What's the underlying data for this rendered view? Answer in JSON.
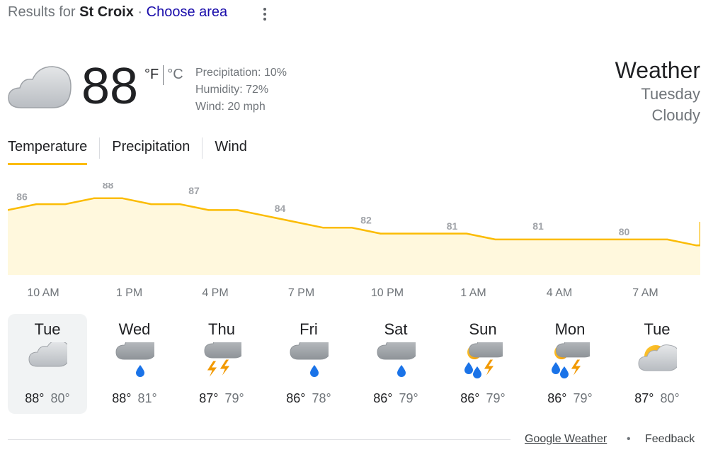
{
  "header": {
    "results_prefix": "Results for ",
    "place": "St Croix",
    "separator": " · ",
    "choose_area": "Choose area"
  },
  "current": {
    "icon": "cloud-icon",
    "temp": "88",
    "unit_f": "°F",
    "unit_c": "°C",
    "precipitation": "Precipitation: 10%",
    "humidity": "Humidity: 72%",
    "wind": "Wind: 20 mph"
  },
  "summary": {
    "title": "Weather",
    "day": "Tuesday",
    "condition": "Cloudy"
  },
  "tabs": [
    {
      "label": "Temperature",
      "active": true
    },
    {
      "label": "Precipitation",
      "active": false
    },
    {
      "label": "Wind",
      "active": false
    }
  ],
  "chart_data": {
    "type": "area",
    "x": [
      "10 AM",
      "1 PM",
      "4 PM",
      "7 PM",
      "10 PM",
      "1 AM",
      "4 AM",
      "7 AM"
    ],
    "labels": [
      86,
      88,
      87,
      84,
      82,
      81,
      81,
      80
    ],
    "hourly": [
      86,
      87,
      87,
      88,
      88,
      87,
      87,
      86,
      86,
      85,
      84,
      83,
      83,
      82,
      82,
      82,
      82,
      81,
      81,
      81,
      81,
      81,
      81,
      81,
      80,
      80,
      81,
      82,
      84
    ],
    "ylim": [
      75,
      90
    ],
    "line_color": "#fbbc04",
    "fill_color": "#fff8dd"
  },
  "forecast": [
    {
      "day": "Tue",
      "icon": "cloud-icon",
      "hi": "88°",
      "lo": "80°",
      "selected": true
    },
    {
      "day": "Wed",
      "icon": "rain-icon",
      "hi": "88°",
      "lo": "81°",
      "selected": false
    },
    {
      "day": "Thu",
      "icon": "thunderstorm-icon",
      "hi": "87°",
      "lo": "79°",
      "selected": false
    },
    {
      "day": "Fri",
      "icon": "rain-icon",
      "hi": "86°",
      "lo": "78°",
      "selected": false
    },
    {
      "day": "Sat",
      "icon": "rain-icon",
      "hi": "86°",
      "lo": "79°",
      "selected": false
    },
    {
      "day": "Sun",
      "icon": "scattered-thunderstorm-icon",
      "hi": "86°",
      "lo": "79°",
      "selected": false
    },
    {
      "day": "Mon",
      "icon": "scattered-thunderstorm-icon",
      "hi": "86°",
      "lo": "79°",
      "selected": false
    },
    {
      "day": "Tue",
      "icon": "partly-cloudy-icon",
      "hi": "87°",
      "lo": "80°",
      "selected": false
    }
  ],
  "footer": {
    "source": "Google Weather",
    "dot": "•",
    "feedback": "Feedback"
  }
}
